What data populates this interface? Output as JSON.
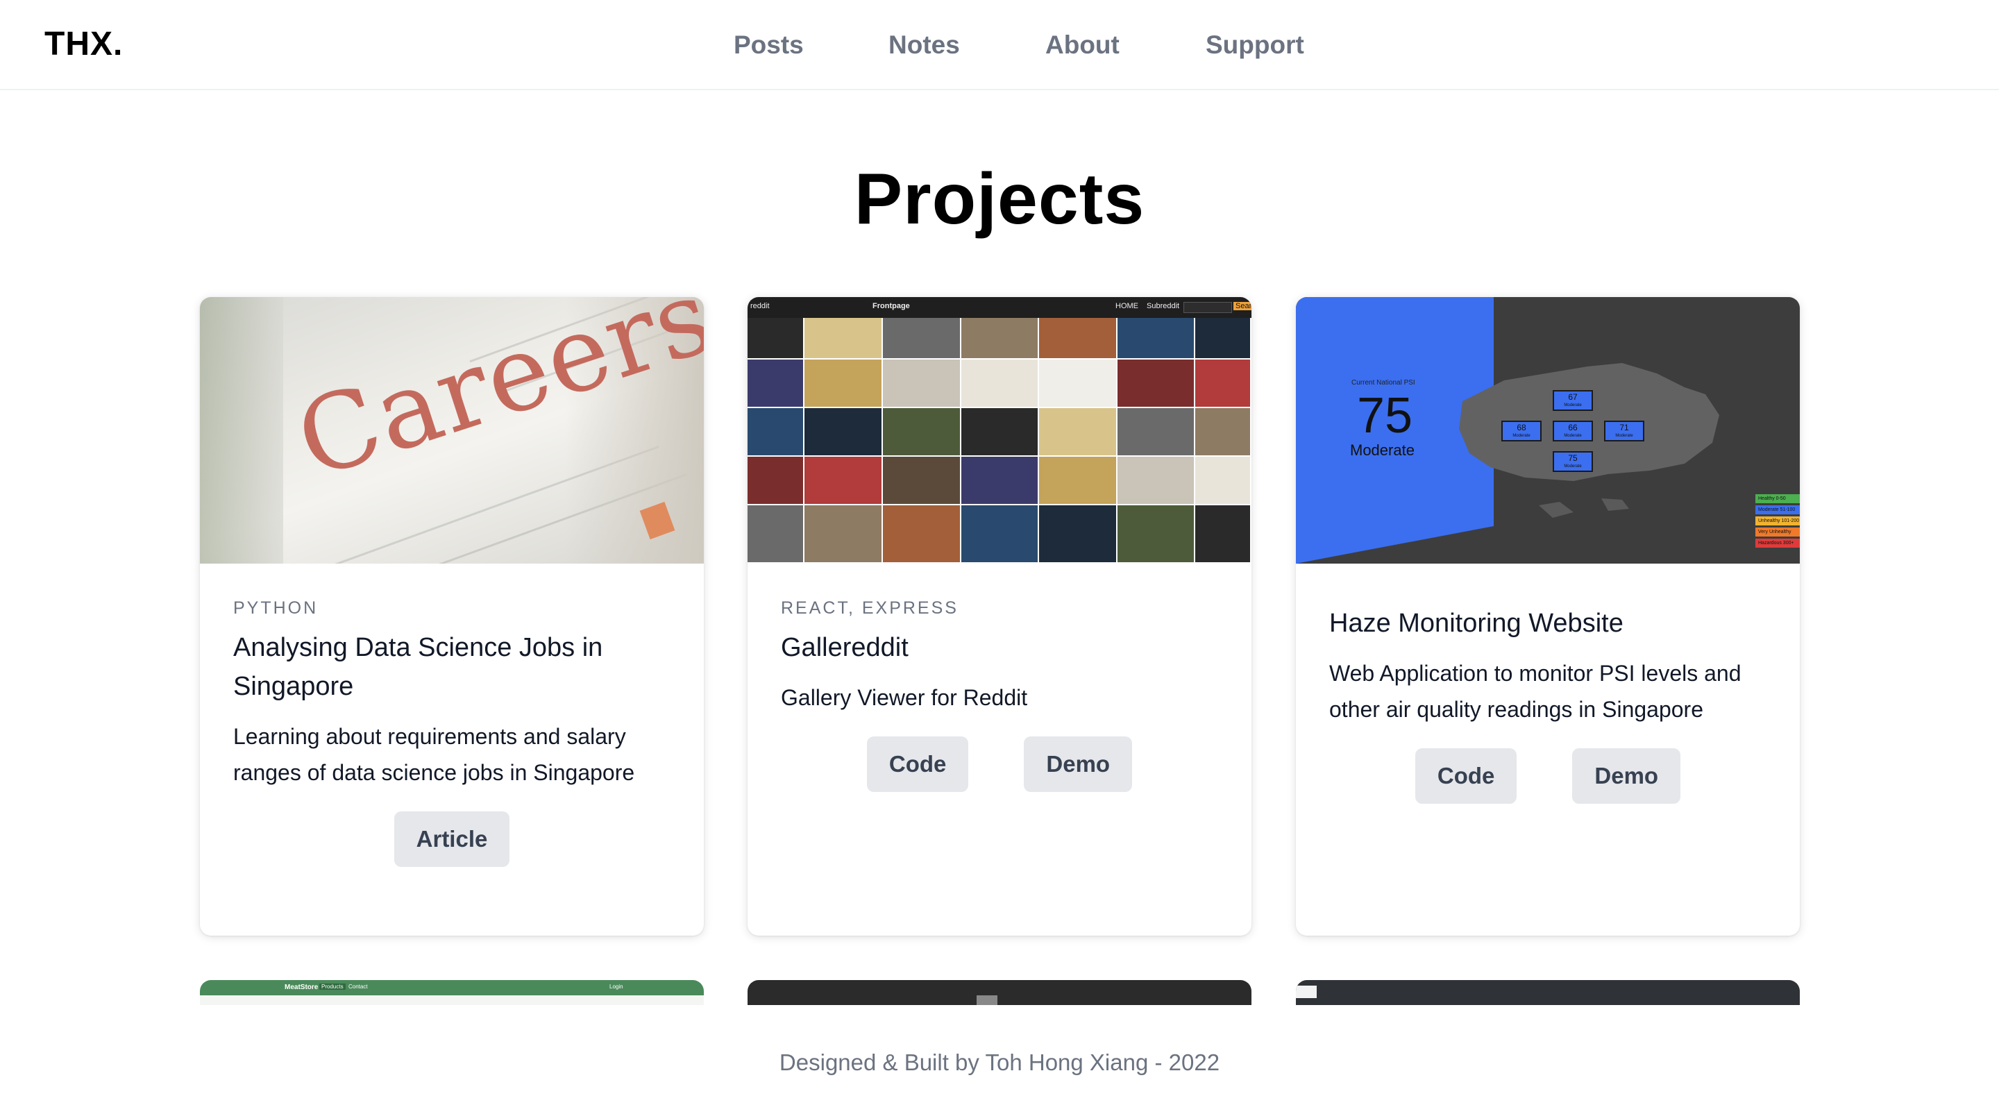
{
  "header": {
    "logo": "THX.",
    "nav": [
      {
        "label": "Posts"
      },
      {
        "label": "Notes"
      },
      {
        "label": "About"
      },
      {
        "label": "Support"
      }
    ]
  },
  "page_title": "Projects",
  "cards": [
    {
      "image_text": "Careers",
      "tags": "PYTHON",
      "title": "Analysing Data Science Jobs in Singapore",
      "description": "Learning about requirements and salary ranges of data science jobs in Singapore",
      "buttons": [
        "Article"
      ]
    },
    {
      "image_header": {
        "brand": "reddit",
        "title": "Frontpage",
        "links": [
          "HOME",
          "Subreddit"
        ],
        "search_button": "Search"
      },
      "tags": "REACT, EXPRESS",
      "title": "Gallereddit",
      "description": "Gallery Viewer for Reddit",
      "buttons": [
        "Code",
        "Demo"
      ]
    },
    {
      "image_overlay": {
        "caption": "Current National PSI",
        "psi_value": "75",
        "psi_label": "Moderate",
        "regions": [
          {
            "value": "67",
            "label": "Moderate"
          },
          {
            "value": "68",
            "label": "Moderate"
          },
          {
            "value": "66",
            "label": "Moderate"
          },
          {
            "value": "71",
            "label": "Moderate"
          },
          {
            "value": "75",
            "label": "Moderate"
          }
        ],
        "legend": [
          "Healthy 0-50",
          "Moderate 51-100",
          "Unhealthy 101-200",
          "Very Unhealthy 201-300",
          "Hazardous 300+"
        ]
      },
      "tags": "",
      "title": "Haze Monitoring Website",
      "description": "Web Application to monitor PSI levels and other air quality readings in Singapore",
      "buttons": [
        "Code",
        "Demo"
      ]
    }
  ],
  "mini_cards": [
    {
      "nav_brand": "MeatStore",
      "nav_items": [
        "Products",
        "Contact"
      ],
      "nav_right": "Login"
    },
    {},
    {}
  ],
  "footer": "Designed & Built by Toh Hong Xiang - 2022",
  "colors": {
    "haze_blue": "#3b6ff0",
    "haze_dark": "#3d3d3d",
    "mini_green": "#4a8a5a",
    "legend": [
      "#4caf50",
      "#3b6ff0",
      "#f2b32f",
      "#f07a2a",
      "#e03b3b"
    ]
  }
}
